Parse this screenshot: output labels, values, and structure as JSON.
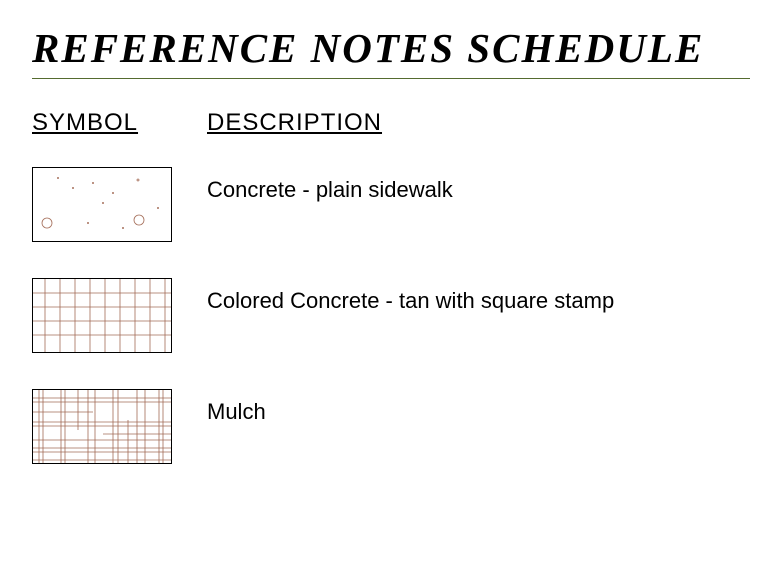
{
  "title": "REFERENCE NOTES SCHEDULE",
  "headers": {
    "symbol": "SYMBOL",
    "description": "DESCRIPTION"
  },
  "rows": [
    {
      "pattern": "dots",
      "description": "Concrete - plain sidewalk"
    },
    {
      "pattern": "grid",
      "description": "Colored Concrete - tan with square stamp"
    },
    {
      "pattern": "mulch",
      "description": "Mulch"
    }
  ],
  "colors": {
    "patternStroke": "#a36b56"
  }
}
